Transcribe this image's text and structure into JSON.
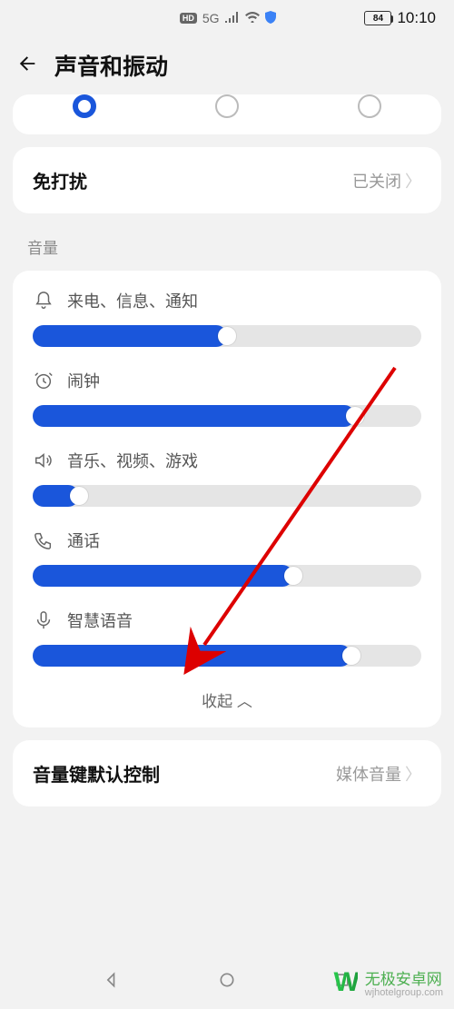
{
  "status": {
    "hd": "HD",
    "net": "5G",
    "battery_pct": "84",
    "time": "10:10"
  },
  "header": {
    "title": "声音和振动"
  },
  "dnd": {
    "label": "免打扰",
    "value": "已关闭"
  },
  "section_volume_title": "音量",
  "sliders": {
    "ring": {
      "label": "来电、信息、通知",
      "percent": 50
    },
    "alarm": {
      "label": "闹钟",
      "percent": 83
    },
    "media": {
      "label": "音乐、视频、游戏",
      "percent": 12
    },
    "call": {
      "label": "通话",
      "percent": 67
    },
    "assistant": {
      "label": "智慧语音",
      "percent": 82
    }
  },
  "collapse_label": "收起",
  "vol_key": {
    "label": "音量键默认控制",
    "value": "媒体音量"
  },
  "watermark": {
    "name": "无极安卓网",
    "url": "wjhotelgroup.com"
  }
}
